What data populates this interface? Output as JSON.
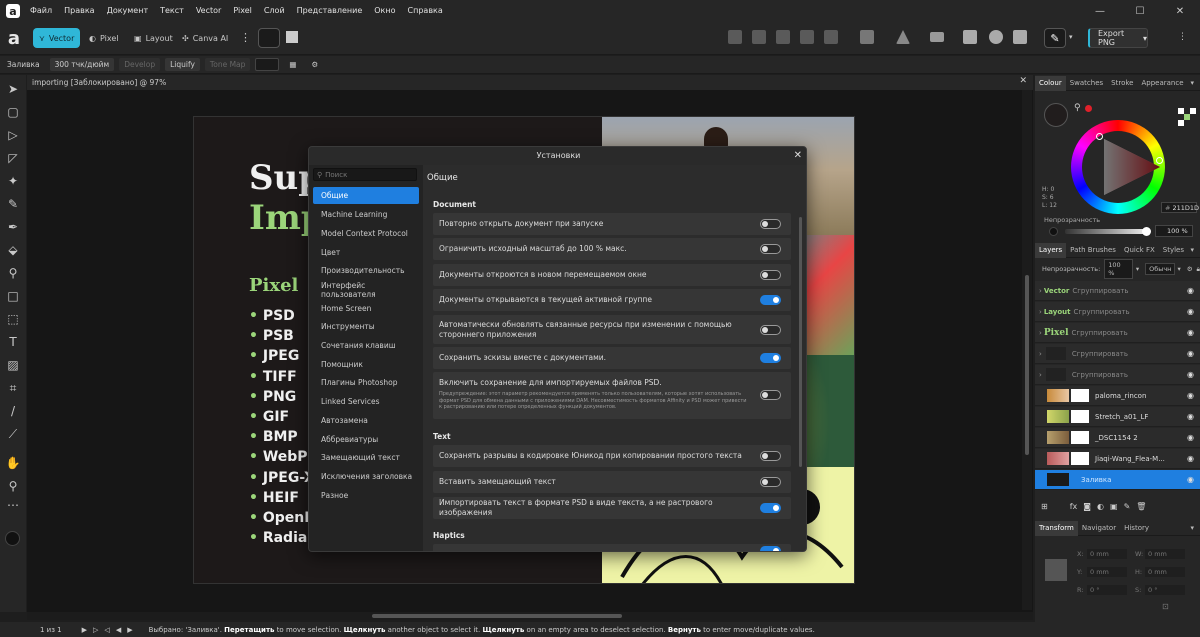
{
  "menu": [
    "Файл",
    "Правка",
    "Документ",
    "Текст",
    "Vector",
    "Pixel",
    "Слой",
    "Представление",
    "Окно",
    "Справка"
  ],
  "toolbar": {
    "personas": [
      "Vector",
      "Pixel",
      "Layout",
      "Canva AI"
    ],
    "export_label": "Export PNG"
  },
  "context": {
    "tool_name": "Заливка",
    "dpi": "300 тчк/дюйм",
    "develop": "Develop",
    "liquify": "Liquify",
    "tonemap": "Tone Map"
  },
  "document": {
    "tab_title": "importing [Заблокировано] @ 97%",
    "title_line1": "Sup",
    "title_line2": "Imp",
    "section_head": "Pixel",
    "formats": [
      "PSD",
      "PSB",
      "JPEG",
      "TIFF",
      "PNG",
      "GIF",
      "BMP",
      "WebP",
      "JPEG-X",
      "HEIF",
      "OpenE",
      "Radian"
    ]
  },
  "dialog": {
    "title": "Установки",
    "search_placeholder": "Поиск",
    "nav": [
      "Общие",
      "Machine Learning",
      "Model Context Protocol",
      "Цвет",
      "Производительность",
      "Интерфейс пользователя",
      "Home Screen",
      "Инструменты",
      "Сочетания клавиш",
      "Помощник",
      "Плагины Photoshop",
      "Linked Services",
      "Автозамена",
      "Аббревиатуры",
      "Замещающий текст",
      "Исключения заголовка",
      "Разное"
    ],
    "page_title": "Общие",
    "sections": {
      "document": "Document",
      "text": "Text",
      "haptics": "Haptics"
    },
    "document_rows": [
      {
        "label": "Повторно открыть документ при запуске",
        "on": false
      },
      {
        "label": "Ограничить исходный масштаб до 100 % макс.",
        "on": false
      },
      {
        "label": "Документы откроются в новом перемещаемом окне",
        "on": false
      },
      {
        "label": "Документы открываются в текущей активной группе",
        "on": true
      },
      {
        "label": "Автоматически обновлять связанные ресурсы при изменении с помощью стороннего приложения",
        "on": false
      },
      {
        "label": "Сохранить эскизы вместе с документами.",
        "on": true
      },
      {
        "label": "Включить сохранение для импортируемых файлов PSD.",
        "note": "Предупреждение: этот параметр рекомендуется применять только пользователям, которые хотят использовать формат PSD для обмена данными с приложениями DAM. Несовместимость форматов Affinity и PSD может привести к растрированию или потере определенных функций документов.",
        "on": false
      }
    ],
    "text_rows": [
      {
        "label": "Сохранять разрывы в кодировке Юникод при копировании простого текста",
        "on": false
      },
      {
        "label": "Вставить замещающий текст",
        "on": false
      },
      {
        "label": "Импортировать текст в формате PSD в виде текста, а не растрового изображения",
        "on": true
      }
    ]
  },
  "colour_panel": {
    "tabs": [
      "Colour",
      "Swatches",
      "Stroke",
      "Appearance"
    ],
    "h": "H: 0",
    "s": "S: 6",
    "l": "L: 12",
    "hex": "211D1D",
    "opacity_label": "Непрозрачность",
    "opacity_value": "100 %"
  },
  "layers_panel": {
    "tabs": [
      "Layers",
      "Path Brushes",
      "Quick FX",
      "Styles"
    ],
    "opacity_label": "Непрозрачность:",
    "opacity_value": "100 %",
    "blend": "Обычн",
    "layers": [
      {
        "tag": "Vector",
        "name": "Сгруппировать"
      },
      {
        "tag": "Layout",
        "name": "Сгруппировать"
      },
      {
        "tag": "Pixel",
        "name": "Сгруппировать"
      },
      {
        "tag": "",
        "name": "Сгруппировать"
      },
      {
        "tag": "",
        "name": "Сгруппировать"
      },
      {
        "tag": "",
        "name": "paloma_rincon"
      },
      {
        "tag": "",
        "name": "Stretch_a01_LF"
      },
      {
        "tag": "",
        "name": "_DSC1154 2"
      },
      {
        "tag": "",
        "name": "Jiaqi-Wang_Flea-M..."
      },
      {
        "tag": "",
        "name": "Заливка"
      }
    ]
  },
  "transform_panel": {
    "tabs": [
      "Transform",
      "Navigator",
      "History"
    ],
    "x": "X:",
    "x_val": "0 mm",
    "y": "Y:",
    "y_val": "0 mm",
    "w": "W:",
    "w_val": "0 mm",
    "h": "H:",
    "h_val": "0 mm",
    "r": "R:",
    "r_val": "0 °",
    "s": "S:",
    "s_val": "0 °"
  },
  "status": {
    "page": "1 из 1",
    "msg_prefix": "Выбрано: 'Заливка'.",
    "k1": "Перетащить",
    "t1": "to move selection.",
    "k2": "Щелкнуть",
    "t2": "another object to select it.",
    "k3": "Щелкнуть",
    "t3": "on an empty area to deselect selection.",
    "k4": "Вернуть",
    "t4": "to enter move/duplicate values."
  },
  "colors": {
    "accent": "#2fb7d8",
    "select": "#1f7fe0",
    "green": "#9bd57a"
  }
}
